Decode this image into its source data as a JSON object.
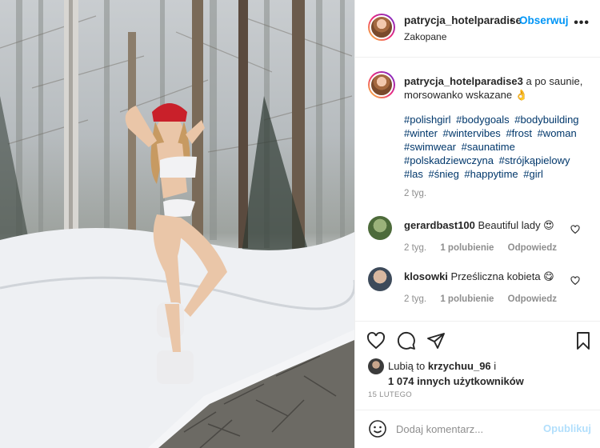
{
  "post": {
    "username": "patrycja_hotelparadise",
    "separator": "•",
    "follow_label": "Obserwuj",
    "location": "Zakopane",
    "more_label": "•••"
  },
  "caption": {
    "username": "patrycja_hotelparadise3",
    "text": "a po saunie, morsowanko wskazane 👌",
    "hashtags": [
      "#polishgirl",
      "#bodygoals",
      "#bodybuilding",
      "#winter",
      "#wintervibes",
      "#frost",
      "#woman",
      "#swimwear",
      "#saunatime",
      "#polskadziewczyna",
      "#strójkąpielowy",
      "#las",
      "#śnieg",
      "#happytime",
      "#girl"
    ],
    "time": "2 tyg."
  },
  "comments": [
    {
      "username": "gerardbast100",
      "text": "Beautiful lady 😍",
      "time": "2 tyg.",
      "likes": "1 polubienie",
      "reply": "Odpowiedz"
    },
    {
      "username": "klosowki",
      "text": "Prześliczna kobieta 😋",
      "time": "2 tyg.",
      "likes": "1 polubienie",
      "reply": "Odpowiedz"
    }
  ],
  "likes": {
    "prefix": "Lubią to",
    "user": "krzychuu_96",
    "suffix": "i",
    "others": "1 074 innych użytkowników"
  },
  "date": "15 LUTEGO",
  "add_comment": {
    "placeholder": "Dodaj komentarz...",
    "post_label": "Opublikuj"
  },
  "icons": {
    "like": "heart-icon",
    "comment": "comment-icon",
    "share": "paper-plane-icon",
    "save": "bookmark-icon",
    "emoji": "smiley-icon"
  },
  "colors": {
    "link_blue": "#0095f6",
    "hashtag_blue": "#00376b",
    "muted_gray": "#8e8e8e",
    "post_disabled": "#b2dffc"
  }
}
